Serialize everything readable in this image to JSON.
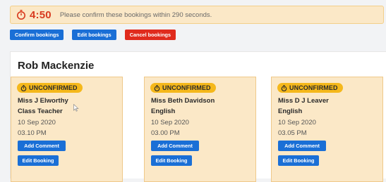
{
  "timer": {
    "value": "4:50",
    "message": "Please confirm these bookings within 290 seconds.",
    "icon": "stopwatch-icon",
    "color": "#d83a1f"
  },
  "actions": {
    "confirm_label": "Confirm bookings",
    "edit_label": "Edit bookings",
    "cancel_label": "Cancel bookings"
  },
  "section": {
    "title": "Rob Mackenzie"
  },
  "cards": [
    {
      "status": "UNCONFIRMED",
      "name": "Miss Beth Davidson",
      "subject": "English",
      "date": "10 Sep 2020",
      "time": "03.00 PM",
      "add_comment_label": "Add Comment",
      "edit_booking_label": "Edit Booking"
    },
    {
      "status": "UNCONFIRMED",
      "name": "Miss D J Leaver",
      "subject": "English",
      "date": "10 Sep 2020",
      "time": "03.05 PM",
      "add_comment_label": "Add Comment",
      "edit_booking_label": "Edit Booking"
    },
    {
      "status": "UNCONFIRMED",
      "name": "Miss J Elworthy",
      "subject": "Class Teacher",
      "date": "10 Sep 2020",
      "time": "03.10 PM",
      "add_comment_label": "Add Comment",
      "edit_booking_label": "Edit Booking"
    }
  ],
  "colors": {
    "accent_blue": "#1a6fd6",
    "danger_red": "#e02b1d",
    "status_amber": "#f5b81b",
    "card_background": "#fbe8c7"
  }
}
